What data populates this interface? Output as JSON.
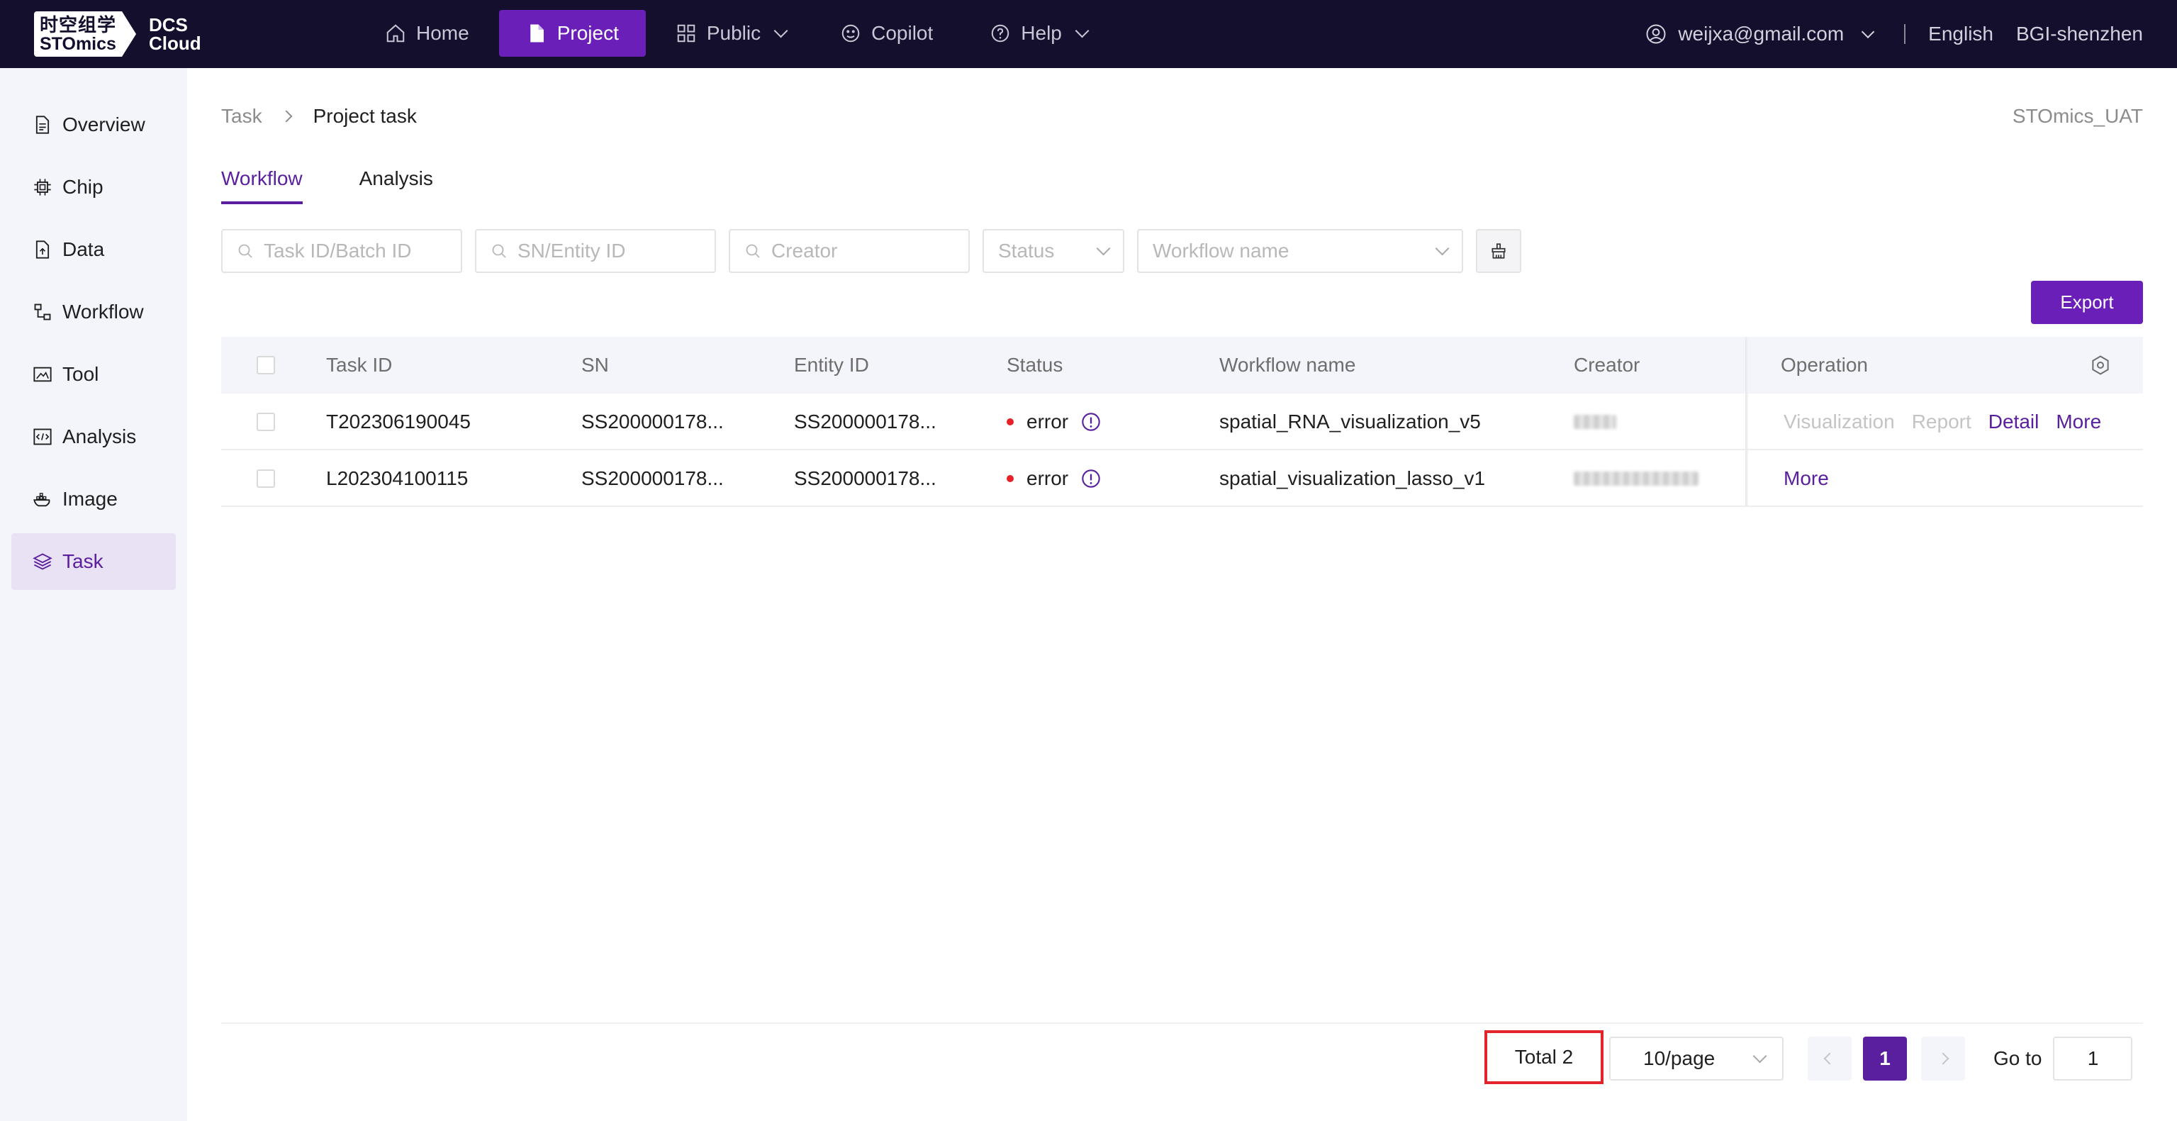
{
  "brand": {
    "logo_cn": "时空组学",
    "logo_en": "STOmics",
    "product_line1": "DCS",
    "product_line2": "Cloud"
  },
  "nav": {
    "home": "Home",
    "project": "Project",
    "public": "Public",
    "copilot": "Copilot",
    "help": "Help"
  },
  "user": {
    "email": "weijxa@gmail.com",
    "language": "English",
    "org": "BGI-shenzhen"
  },
  "sidebar": {
    "items": [
      {
        "label": "Overview",
        "icon": "document-icon"
      },
      {
        "label": "Chip",
        "icon": "chip-icon"
      },
      {
        "label": "Data",
        "icon": "file-upload-icon"
      },
      {
        "label": "Workflow",
        "icon": "workflow-icon"
      },
      {
        "label": "Tool",
        "icon": "tool-icon"
      },
      {
        "label": "Analysis",
        "icon": "code-icon"
      },
      {
        "label": "Image",
        "icon": "docker-icon"
      },
      {
        "label": "Task",
        "icon": "layers-icon"
      }
    ],
    "active": "Task"
  },
  "breadcrumb": {
    "parent": "Task",
    "current": "Project task"
  },
  "tenant": "STOmics_UAT",
  "tabs": {
    "workflow": "Workflow",
    "analysis": "Analysis",
    "active": "Workflow"
  },
  "filters": {
    "task_id_placeholder": "Task ID/Batch ID",
    "sn_placeholder": "SN/Entity ID",
    "creator_placeholder": "Creator",
    "status_placeholder": "Status",
    "workflow_placeholder": "Workflow name"
  },
  "export_label": "Export",
  "table": {
    "headers": {
      "task_id": "Task ID",
      "sn": "SN",
      "entity_id": "Entity ID",
      "status": "Status",
      "workflow_name": "Workflow name",
      "creator": "Creator",
      "operation": "Operation"
    },
    "rows": [
      {
        "task_id": "T202306190045",
        "sn": "SS200000178...",
        "entity_id": "SS200000178...",
        "status": "error",
        "workflow_name": "spatial_RNA_visualization_v5",
        "ops": {
          "visualization": "Visualization",
          "report": "Report",
          "detail": "Detail",
          "more": "More"
        }
      },
      {
        "task_id": "L202304100115",
        "sn": "SS200000178...",
        "entity_id": "SS200000178...",
        "status": "error",
        "workflow_name": "spatial_visualization_lasso_v1",
        "ops": {
          "more": "More"
        }
      }
    ]
  },
  "pagination": {
    "total": "Total 2",
    "page_size": "10/page",
    "current_page": "1",
    "goto_label": "Go to",
    "goto_value": "1"
  },
  "colors": {
    "nav_bg": "#150f2e",
    "accent": "#6a1fb8",
    "accent_text": "#5a1f9e",
    "error": "#e8202a",
    "highlight_box": "#e3252b"
  }
}
